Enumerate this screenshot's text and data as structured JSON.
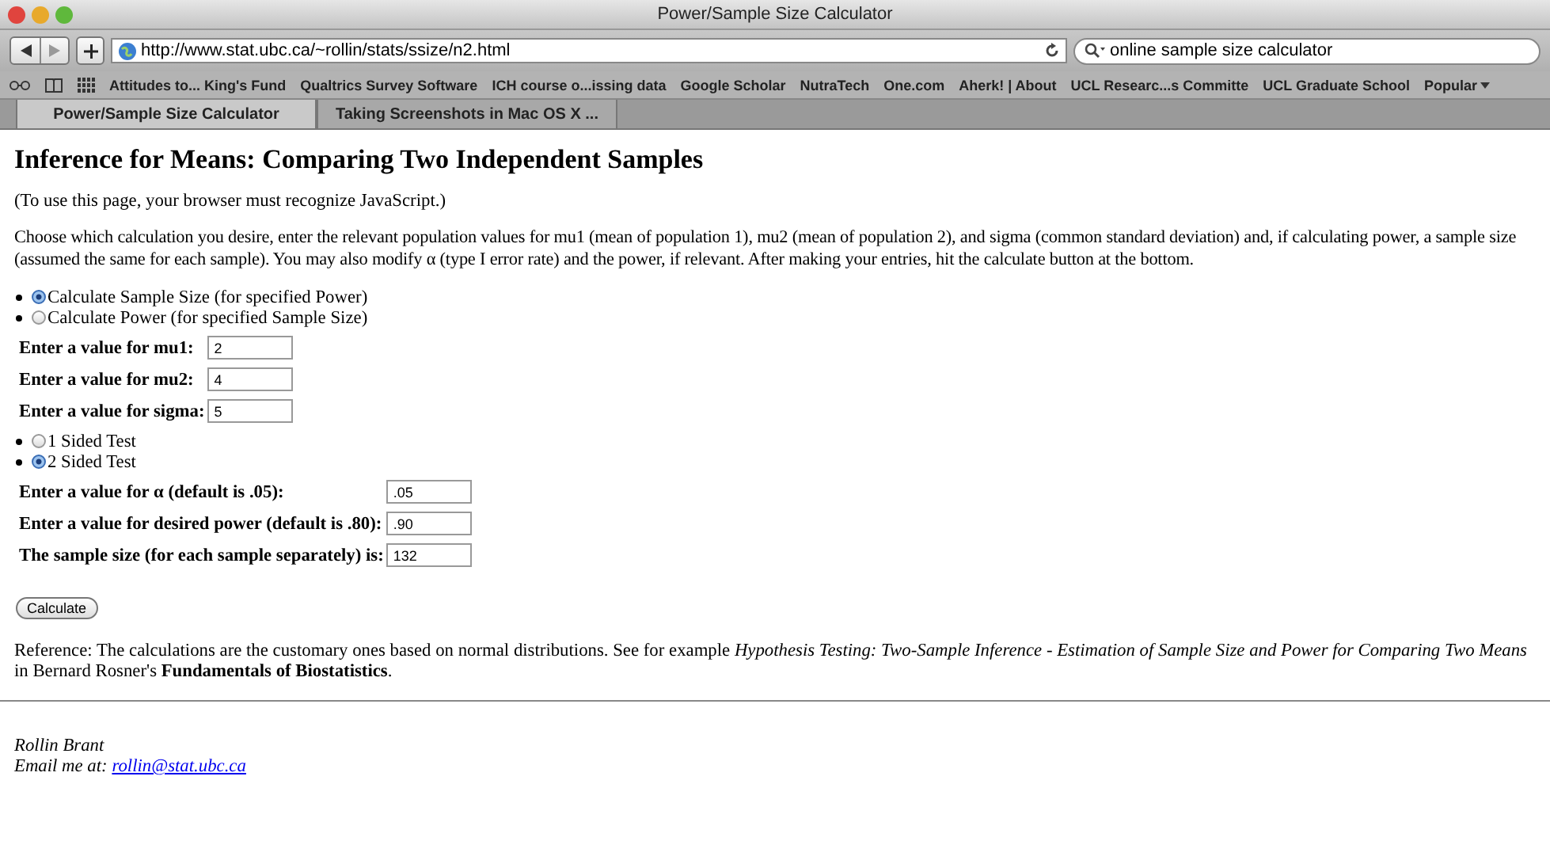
{
  "window": {
    "title": "Power/Sample Size Calculator"
  },
  "toolbar": {
    "url": "http://www.stat.ubc.ca/~rollin/stats/ssize/n2.html",
    "search": "online sample size calculator"
  },
  "bookmarks": [
    {
      "label": "Attitudes to... King's Fund",
      "menu": false
    },
    {
      "label": "Qualtrics Survey Software",
      "menu": false
    },
    {
      "label": "ICH course o...issing data",
      "menu": false
    },
    {
      "label": "Google Scholar",
      "menu": false
    },
    {
      "label": "NutraTech",
      "menu": false
    },
    {
      "label": "One.com",
      "menu": false
    },
    {
      "label": "Aherk! | About",
      "menu": false
    },
    {
      "label": "UCL Researc...s Committe",
      "menu": false
    },
    {
      "label": "UCL Graduate School",
      "menu": false
    },
    {
      "label": "Popular",
      "menu": true
    }
  ],
  "tabs": [
    {
      "label": "Power/Sample Size Calculator",
      "selected": true
    },
    {
      "label": "Taking Screenshots in Mac OS X ...",
      "selected": false
    }
  ],
  "page": {
    "heading": "Inference for Means: Comparing Two Independent Samples",
    "note": "(To use this page, your browser must recognize JavaScript.)",
    "intro": [
      "Choose which calculation you desire, enter the relevant population values for mu1 (mean of population 1), mu2 (mean of population 2), and sigma (common standard deviation) and, if calculating power, a sample size",
      "(assumed the same for each sample). You may also modify α (type I error rate) and the power, if relevant. After making your entries, hit the calculate button at the bottom."
    ],
    "mode_options": [
      {
        "label": "Calculate Sample Size (for specified Power)",
        "selected": true
      },
      {
        "label": "Calculate Power (for specified Sample Size)",
        "selected": false
      }
    ],
    "mean_fields": [
      {
        "label": "Enter a value for mu1:",
        "value": "2"
      },
      {
        "label": "Enter a value for mu2:",
        "value": "4"
      },
      {
        "label": "Enter a value for sigma:",
        "value": "5"
      }
    ],
    "test_options": [
      {
        "label": "1 Sided Test",
        "selected": false
      },
      {
        "label": "2 Sided Test",
        "selected": true
      }
    ],
    "power_fields": [
      {
        "label": "Enter a value for α (default is .05):",
        "value": ".05"
      },
      {
        "label": "Enter a value for desired power (default is .80):",
        "value": ".90"
      },
      {
        "label": "The sample size (for each sample separately) is:",
        "value": "132"
      }
    ],
    "button": "Calculate",
    "reference": "Reference: The calculations are the customary ones based on normal distributions. See for example *Hypothesis Testing: Two-Sample Inference - Estimation of Sample Size and Power for Comparing Two Means* in Bernard Rosner's **Fundamentals of Biostatistics**.",
    "author": "Rollin Brant",
    "email_label": "Email me at:",
    "email": "rollin@stat.ubc.ca"
  }
}
